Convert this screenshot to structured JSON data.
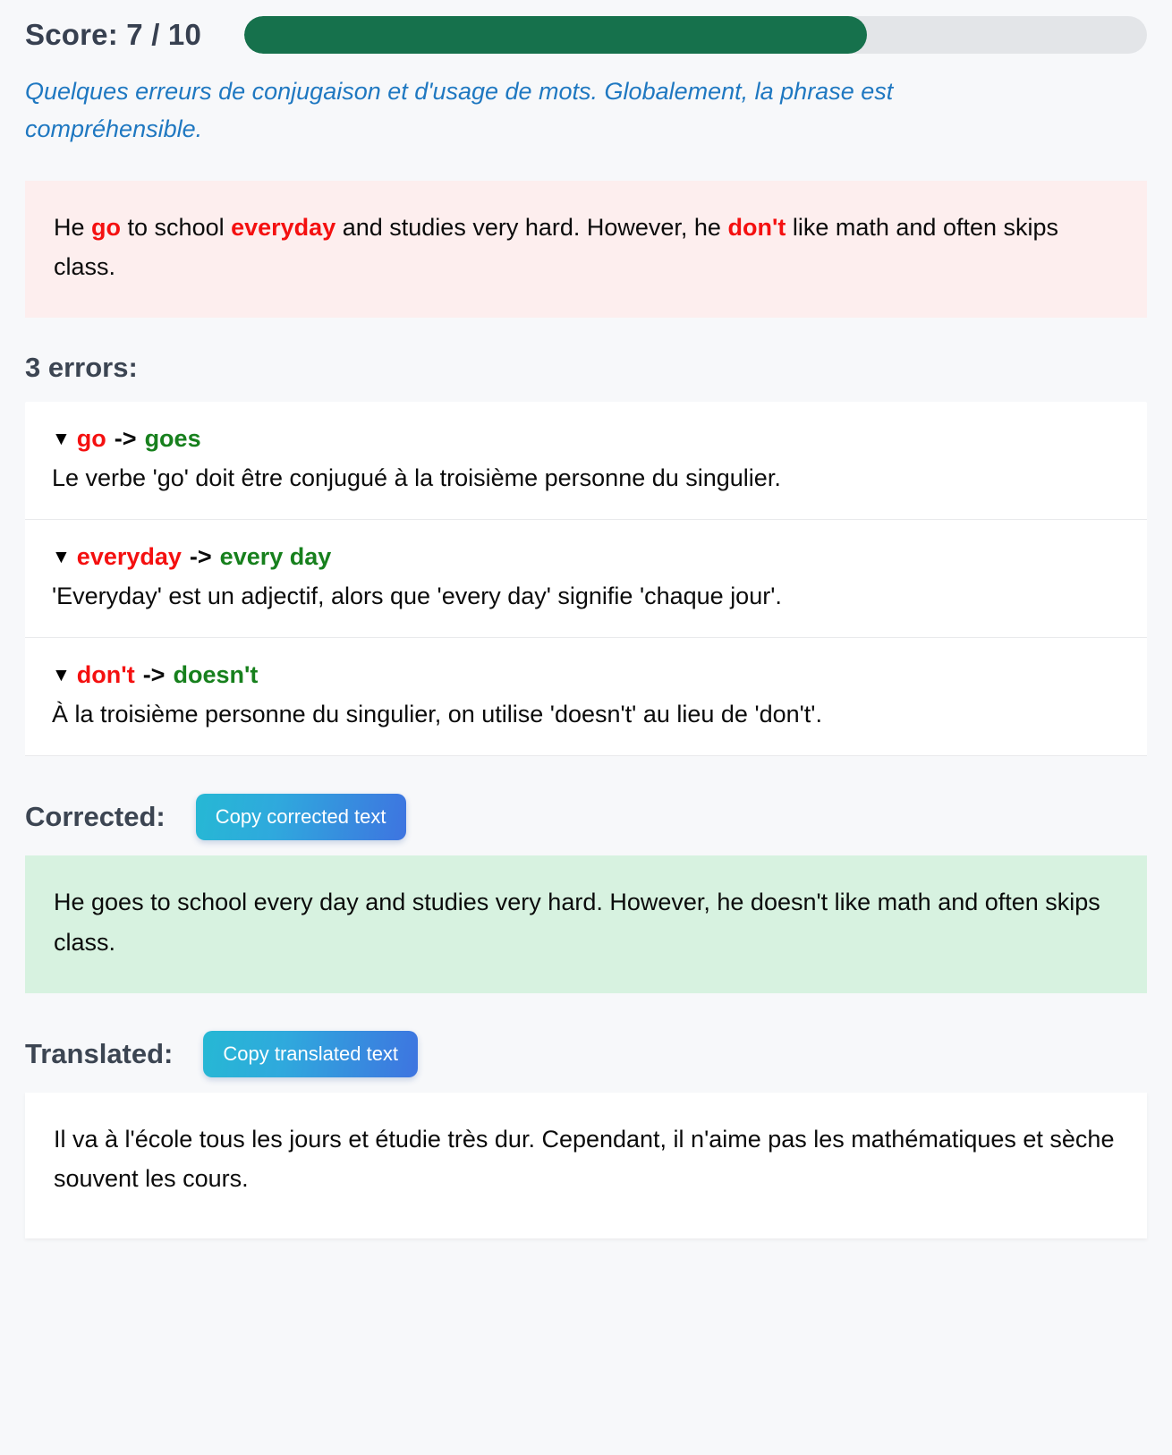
{
  "score": {
    "label": "Score: 7 / 10",
    "value": 7,
    "max": 10,
    "percent": 69,
    "bar_fill_color": "#16714c",
    "bar_track_color": "#e3e5e8"
  },
  "summary": "Quelques erreurs de conjugaison et d'usage de mots. Globalement, la phrase est compréhensible.",
  "original": {
    "segments": [
      {
        "text": "He ",
        "highlight": false
      },
      {
        "text": "go",
        "highlight": true
      },
      {
        "text": " to school ",
        "highlight": false
      },
      {
        "text": "everyday",
        "highlight": true
      },
      {
        "text": " and studies very hard. However, he ",
        "highlight": false
      },
      {
        "text": "don't",
        "highlight": true
      },
      {
        "text": " like math and often skips class.",
        "highlight": false
      }
    ],
    "background_color": "#fdeeee",
    "highlight_color": "#f41010"
  },
  "errors_heading": "3 errors:",
  "errors": [
    {
      "caret": "▼",
      "wrong": "go",
      "arrow": "->",
      "right": "goes",
      "description": "Le verbe 'go' doit être conjugué à la troisième personne du singulier."
    },
    {
      "caret": "▼",
      "wrong": "everyday",
      "arrow": "->",
      "right": "every day",
      "description": "'Everyday' est un adjectif, alors que 'every day' signifie 'chaque jour'."
    },
    {
      "caret": "▼",
      "wrong": "don't",
      "arrow": "->",
      "right": "doesn't",
      "description": "À la troisième personne du singulier, on utilise 'doesn't' au lieu de 'don't'."
    }
  ],
  "corrected": {
    "title": "Corrected:",
    "copy_button": "Copy corrected text",
    "text": "He goes to school every day and studies very hard. However, he doesn't like math and often skips class.",
    "background_color": "#d7f2e0"
  },
  "translated": {
    "title": "Translated:",
    "copy_button": "Copy translated text",
    "text": "Il va à l'école tous les jours et étudie très dur. Cependant, il n'aime pas les mathématiques et sèche souvent les cours.",
    "background_color": "#ffffff"
  }
}
